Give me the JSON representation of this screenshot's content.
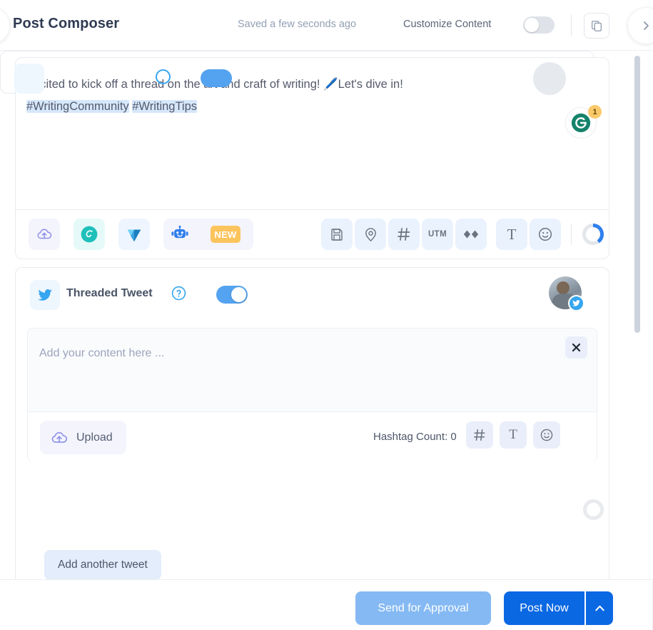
{
  "header": {
    "title": "Post Composer",
    "saved_status": "Saved a few seconds ago",
    "customize_label": "Customize Content",
    "customize_toggle_state": "off",
    "copy_icon": "copy-icon",
    "next_icon": "chevron-right-icon",
    "prev_icon": "chevron-left-icon"
  },
  "composer": {
    "text_line1": "Excited to kick off a thread on the art and craft of writing! 🖊️Let's dive in!",
    "hashtag1": "#WritingCommunity",
    "hashtag2": "#WritingTips",
    "grammarly_icon": "grammarly-icon",
    "grammarly_badge": "1",
    "media_tools": [
      {
        "name": "upload-icon",
        "label": "Upload"
      },
      {
        "name": "canva-icon",
        "label": "Canva"
      },
      {
        "name": "vista-create-icon",
        "label": "Vista Create"
      },
      {
        "name": "ai-assistant-icon",
        "label": "AI Assistant"
      }
    ],
    "new_badge": "NEW",
    "format_tools": [
      {
        "name": "save-icon",
        "label": "Save"
      },
      {
        "name": "location-pin-icon",
        "label": "Location"
      },
      {
        "name": "hashtag-icon",
        "label": "Hashtag"
      },
      {
        "name": "utm-icon",
        "label": "UTM"
      },
      {
        "name": "link-shortener-icon",
        "label": "Shorten Link"
      },
      {
        "name": "text-format-icon",
        "label": "Text"
      },
      {
        "name": "emoji-icon",
        "label": "Emoji"
      }
    ],
    "utm_label": "UTM",
    "text_tool_label": "T",
    "progress_ring_percent": 40
  },
  "thread": {
    "platform_icon": "twitter-icon",
    "title": "Threaded Tweet",
    "help_icon": "help-circle-icon",
    "toggle_state": "on",
    "avatar_name": "avatar",
    "avatar_badge_icon": "twitter-icon",
    "close_icon": "close-icon",
    "content_placeholder": "Add your content here ...",
    "upload_label": "Upload",
    "upload_icon": "upload-icon",
    "hashtag_count_label": "Hashtag Count: 0",
    "sub_tools": [
      {
        "name": "hashtag-icon",
        "label": "Hashtag"
      },
      {
        "name": "text-format-icon",
        "label": "T"
      },
      {
        "name": "emoji-icon",
        "label": "Emoji"
      }
    ],
    "text_tool_label": "T",
    "progress_ring_percent": 0,
    "add_another_label": "Add another tweet",
    "callout_arrow": "left-arrow-annotation"
  },
  "footer": {
    "send_approval_label": "Send for Approval",
    "post_now_label": "Post Now",
    "post_caret_icon": "chevron-up-icon"
  },
  "colors": {
    "accent_blue": "#0b68e3",
    "light_blue": "#85b9f3",
    "twitter_blue": "#35a6ef",
    "toggle_on": "#54a3f0",
    "toggle_off": "#dfe3e9",
    "badge_yellow": "#fbc96a",
    "hashtag_highlight": "#d6e7fb",
    "title_color": "#2f3b52",
    "muted_text": "#93a0b5"
  }
}
